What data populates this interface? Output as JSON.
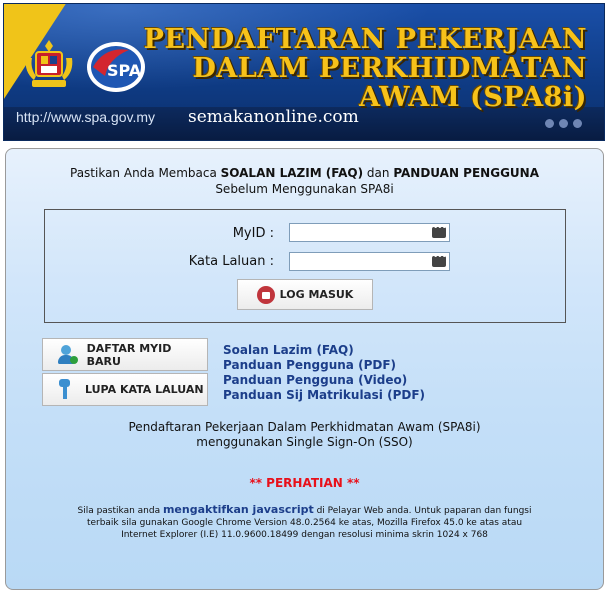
{
  "banner": {
    "title_line1": "PENDAFTARAN PEKERJAAN",
    "title_line2": "DALAM PERKHIDMATAN",
    "title_line3": "AWAM (SPA8i)",
    "url": "http://www.spa.gov.my",
    "semakan": "semakanonline.com",
    "logo_text": "SPA"
  },
  "notice": {
    "pre": "Pastikan Anda Membaca ",
    "faq": "SOALAN LAZIM (FAQ)",
    "mid": " dan ",
    "guide": "PANDUAN PENGGUNA",
    "line2": "Sebelum Menggunakan SPA8i"
  },
  "login": {
    "myid_label": "MyID :",
    "myid_value": "",
    "password_label": "Kata Laluan :",
    "password_value": "",
    "submit_label": "LOG MASUK"
  },
  "actions": {
    "register_label": "DAFTAR MYID BARU",
    "forgot_label": "LUPA KATA LALUAN"
  },
  "links": [
    "Soalan Lazim (FAQ)",
    "Panduan Pengguna (PDF)",
    "Panduan Pengguna (Video)",
    "Panduan Sij Matrikulasi (PDF)"
  ],
  "sso": {
    "line1": "Pendaftaran Pekerjaan Dalam Perkhidmatan Awam (SPA8i)",
    "line2": "menggunakan Single Sign-On (SSO)"
  },
  "warning": {
    "heading": "** PERHATIAN **",
    "pre": "Sila pastikan anda ",
    "emph": "mengaktifkan javascript",
    "post": " di Pelayar Web anda. Untuk paparan dan fungsi",
    "line2": "terbaik sila gunakan Google Chrome Version 48.0.2564 ke atas, Mozilla Firefox 45.0 ke atas atau",
    "line3": "Internet Explorer (I.E) 11.0.9600.18499 dengan resolusi minima skrin 1024 x 768"
  },
  "colors": {
    "banner_blue": "#0f3c86",
    "title_gold": "#f7c21a",
    "link_blue": "#1c3e8a",
    "warning_red": "#e8101a"
  }
}
